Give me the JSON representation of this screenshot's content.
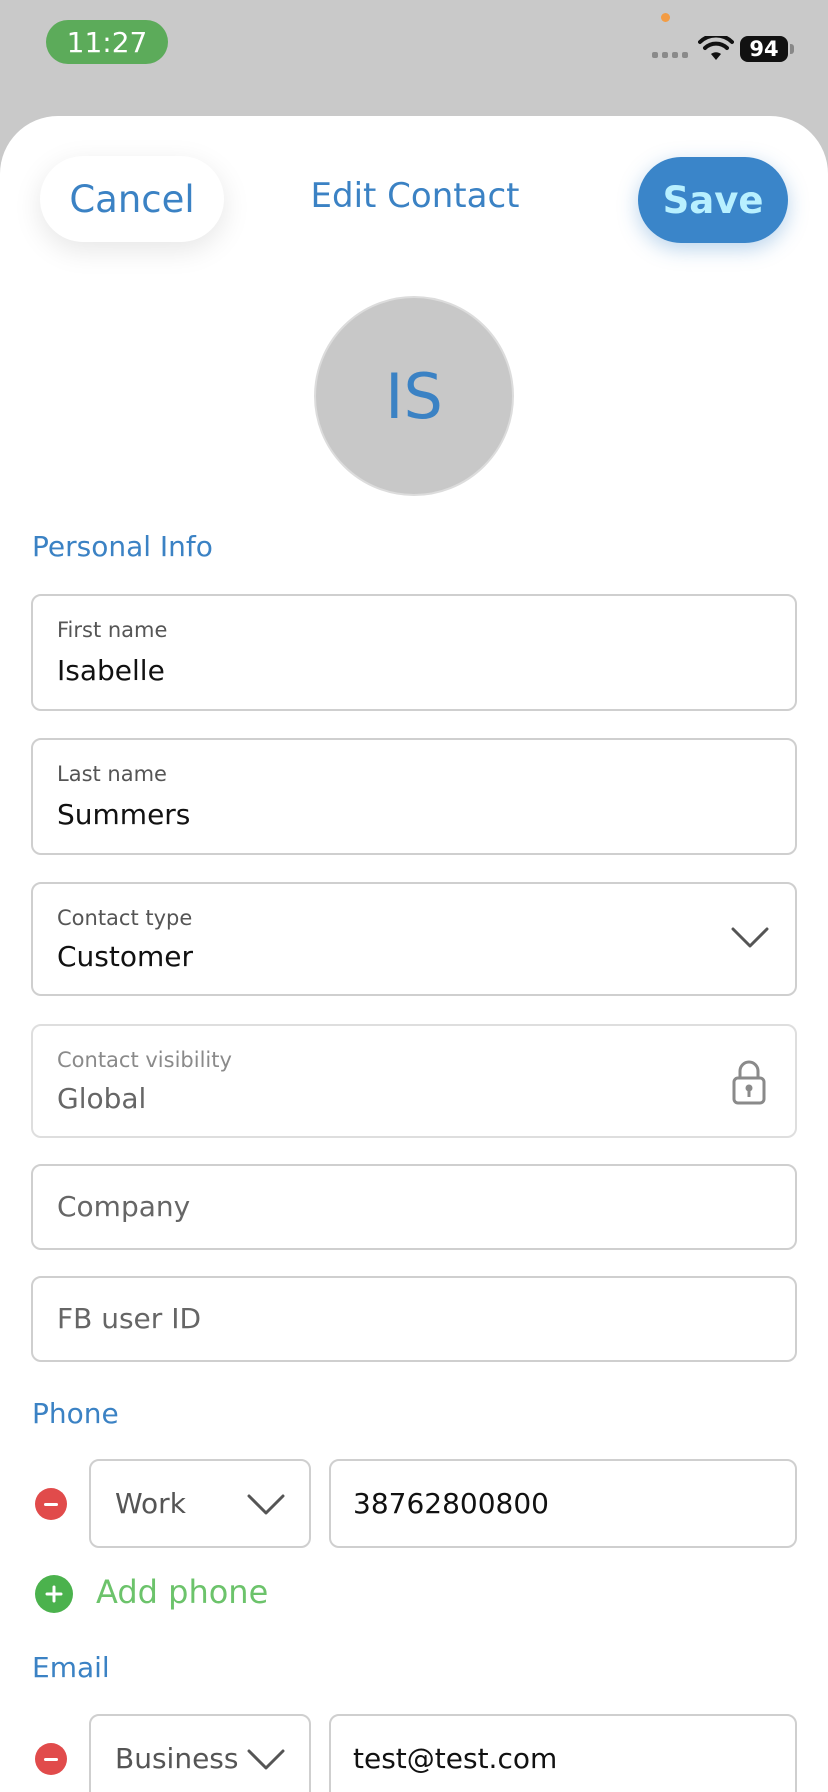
{
  "status_bar": {
    "time": "11:27",
    "battery": "94"
  },
  "header": {
    "cancel_label": "Cancel",
    "title": "Edit Contact",
    "save_label": "Save"
  },
  "avatar": {
    "initials": "IS"
  },
  "personal_info": {
    "section_label": "Personal Info",
    "first_name": {
      "label": "First name",
      "value": "Isabelle"
    },
    "last_name": {
      "label": "Last name",
      "value": "Summers"
    },
    "contact_type": {
      "label": "Contact type",
      "value": "Customer"
    },
    "contact_visibility": {
      "label": "Contact visibility",
      "value": "Global"
    },
    "company": {
      "placeholder": "Company"
    },
    "fb_user_id": {
      "placeholder": "FB user ID"
    }
  },
  "phone": {
    "section_label": "Phone",
    "entries": [
      {
        "type": "Work",
        "value": "38762800800"
      }
    ],
    "add_label": "Add phone"
  },
  "email": {
    "section_label": "Email",
    "entries": [
      {
        "type": "Business",
        "value": "test@test.com"
      }
    ]
  },
  "colors": {
    "accent": "#3b82c4",
    "save_button": "#3a85c9",
    "remove": "#e14b4b",
    "add": "#4bb24d",
    "status_time_bg": "#5cab5a"
  }
}
